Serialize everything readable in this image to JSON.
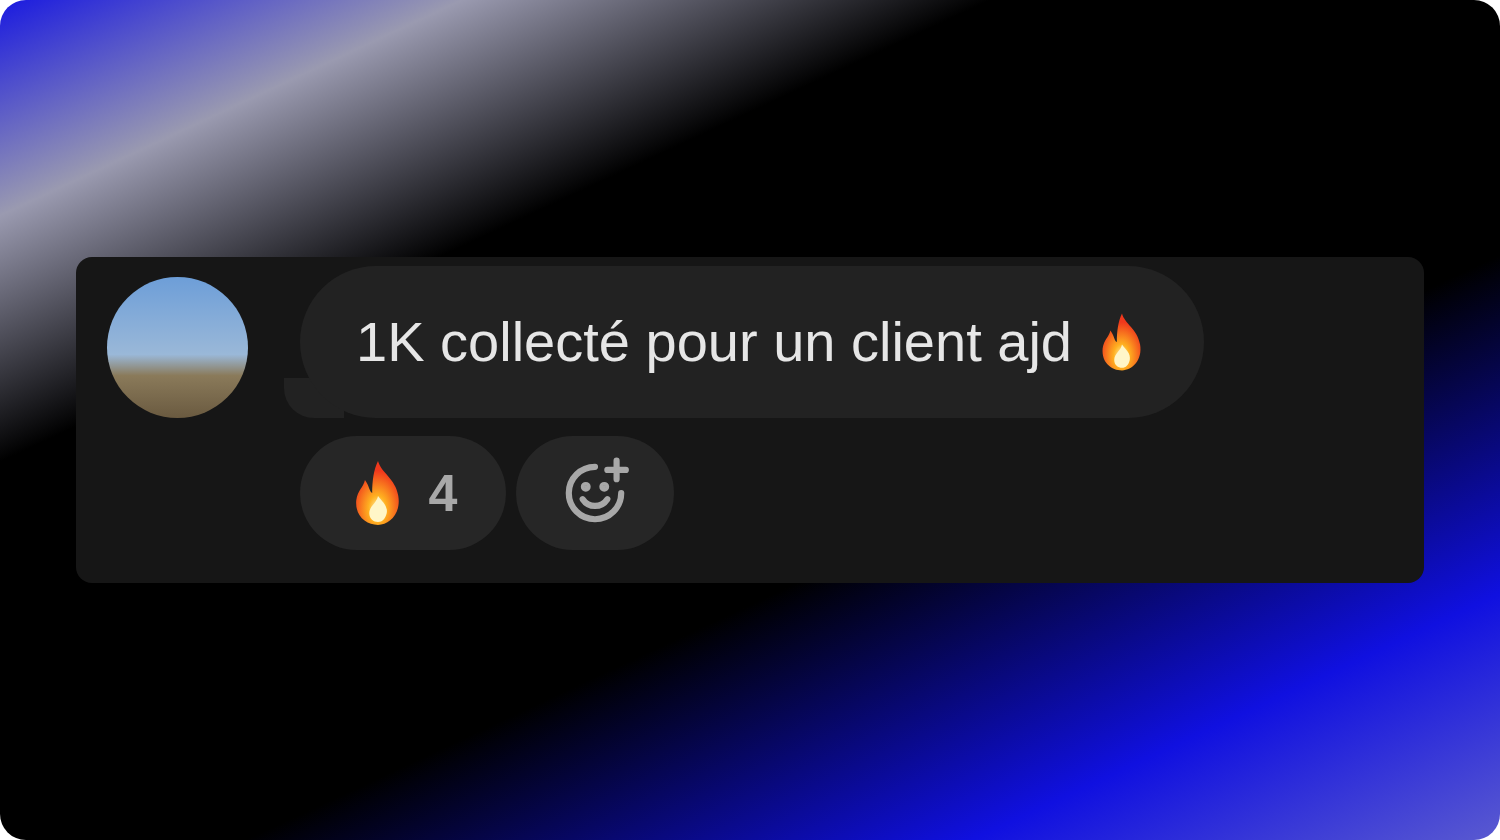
{
  "message": {
    "text": "1K collecté pour un client ajd"
  },
  "reactions": [
    {
      "count": "4"
    }
  ]
}
